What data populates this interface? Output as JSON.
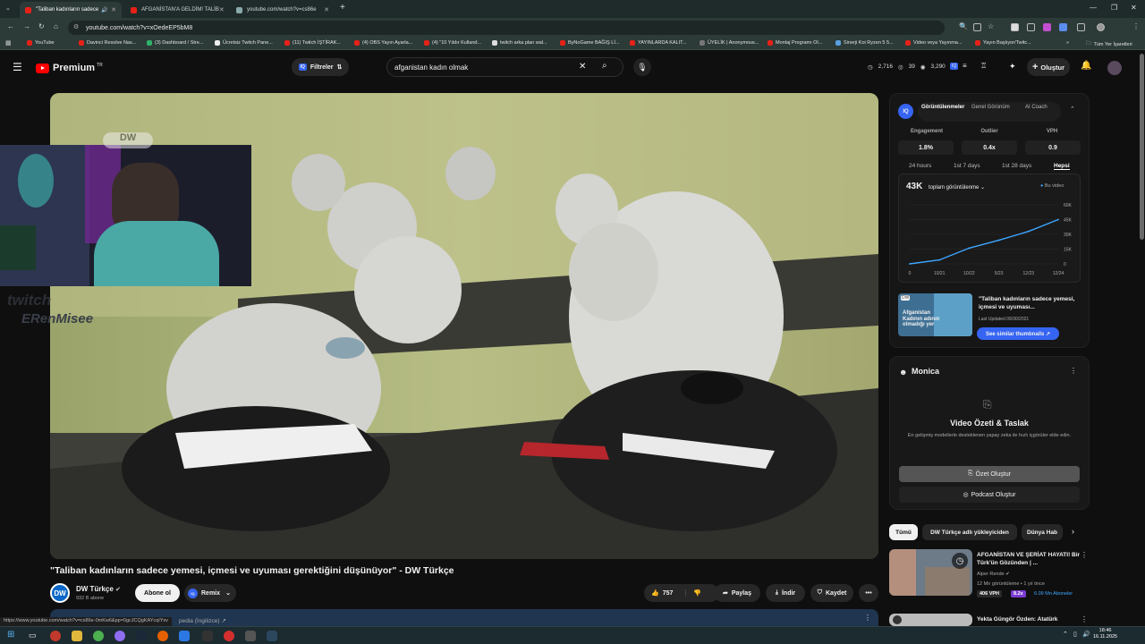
{
  "browser": {
    "tabs": [
      {
        "label": "\"Taliban kadınların sadece"
      },
      {
        "label": "AFGANİSTAN'A GELDİM! TALİB"
      },
      {
        "label": "youtube.com/watch?v=cs86e"
      }
    ],
    "url": "youtube.com/watch?v=xOedeEP5bM8",
    "bookmarks": [
      "YouTube",
      "Davinci Resolve Nas...",
      "(3) Dashboard / Stre...",
      "Ücretsiz Twitch Pane...",
      "(11) Twitch İŞTİRAK...",
      "(4) OBS Yayın Ayarla...",
      "(4) \"10 Yıldır Kulland...",
      "twitch arka plan wal...",
      "ByNoGame BAĞIŞ Lİ...",
      "YAYINLARDA KALIT...",
      "ÜYELİK | Anonymous...",
      "Montaj Programı Ol...",
      "Sinerji Koi Ryzen 5 5...",
      "Video veya Yayınma...",
      "Yayın Başlıyor/Twitc..."
    ],
    "other_bookmarks": "Tüm Yer İşaretleri"
  },
  "yt_header": {
    "logo": "Premium",
    "logo_region": "TR",
    "filters": "Filtreler",
    "search_value": "afganistan  kadın olmak",
    "stats": [
      "2,716",
      "39",
      "3,290"
    ],
    "create": "Oluştur"
  },
  "overlay": {
    "twitch": "twitch",
    "streamer": "ERenMisee",
    "dw": "DW"
  },
  "video": {
    "title": "\"Taliban kadınların sadece yemesi, içmesi ve uyuması gerektiğini düşünüyor\" - DW Türkçe",
    "channel": "DW Türkçe",
    "channel_avatar": "DW",
    "subscribers": "932 B abone",
    "subscribe": "Abone ol",
    "remix": "Remix",
    "likes": "757",
    "share": "Paylaş",
    "download": "İndir",
    "save": "Kaydet",
    "desc_snippet": "pedia (İngilizce) ↗",
    "status_url": "https://www.youtube.com/watch?v=cs86e-0mKw6&pp=0gcJCQgKAYcqIYsv"
  },
  "vidiq": {
    "tabs": [
      "Görüntülenmeler",
      "Genel Görünüm",
      "AI Coach"
    ],
    "metrics": [
      {
        "label": "Engagement",
        "value": "1.8%"
      },
      {
        "label": "Outlier",
        "value": "0.4x"
      },
      {
        "label": "VPH",
        "value": "0.9"
      }
    ],
    "ranges": [
      "24 hours",
      "1st 7 days",
      "1st 28 days",
      "Hepsi"
    ],
    "total": "43K",
    "total_label": "toplam görüntülenme",
    "legend": "Bu video",
    "thumb_title": "\"Taliban kadınların sadece yemesi, içmesi ve uyuması...",
    "thumb_updated": "Last Updated 09/30/2021",
    "thumb_overlay": "Afganistan Kadının adının olmadığı yer",
    "thumb_btn": "See similar thumbnails ↗"
  },
  "chart_data": {
    "type": "line",
    "title": "",
    "x": [
      "0",
      "10/21",
      "10/22",
      "5/23",
      "12/23",
      "12/24"
    ],
    "series": [
      {
        "name": "Bu video",
        "values": [
          0,
          4,
          16,
          24,
          33,
          45
        ]
      }
    ],
    "ylim": [
      0,
      60
    ],
    "yticks": [
      "60K",
      "45K",
      "30K",
      "15K",
      "0"
    ],
    "color": "#3ea6ff"
  },
  "monica": {
    "title": "Monica",
    "heading": "Video Özeti & Taslak",
    "sub": "En gelişmiş modellerle desteklenen yapay zeka ile hızlı içgörüler elde edin.",
    "summary_btn": "Özet Oluştur",
    "podcast_btn": "Podcast Oluştur"
  },
  "chips": [
    "Tümü",
    "DW Türkçe adlı yükleyiciden",
    "Dünya Hab"
  ],
  "recommendations": [
    {
      "title": "AFGANİSTAN VE ŞERİAT HAYATI! Bir Türk'ün Gözünden | ...",
      "channel": "Alper Rende",
      "meta": "12 Mn görüntüleme  •  1 yıl önce",
      "vph": "406 VPH",
      "outlier": "8.2x",
      "subs_per": "6.09 Mn Aboneler"
    },
    {
      "title": "Yekta Güngör Özden: Atatürk",
      "channel": "",
      "meta": "",
      "vph": "",
      "outlier": "",
      "subs_per": ""
    }
  ],
  "clock": {
    "time": "18:46",
    "date": "16.11.2025"
  }
}
